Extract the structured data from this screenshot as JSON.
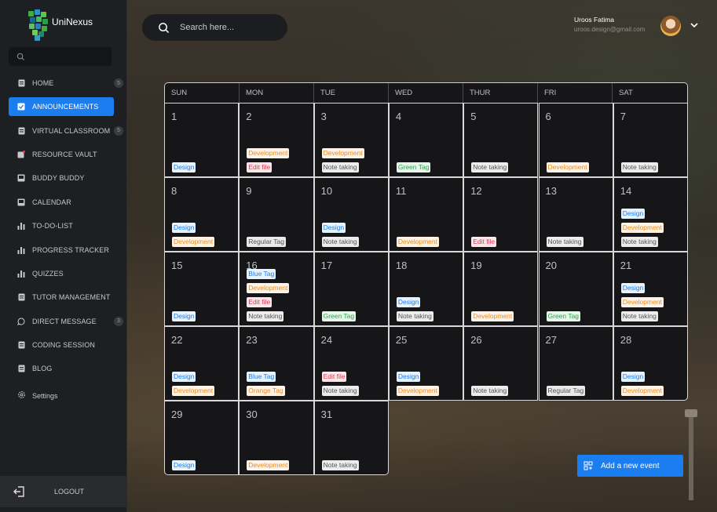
{
  "app": {
    "name": "UniNexus"
  },
  "sidebar": {
    "search_placeholder": "",
    "items": [
      {
        "label": "HOME",
        "icon": "clipboard-icon",
        "badge": "5"
      },
      {
        "label": "ANNOUNCEMENTS",
        "icon": "checkbox-icon",
        "active": true
      },
      {
        "label": "VIRTUAL CLASSROOM",
        "icon": "clipboard-icon",
        "badge": "5"
      },
      {
        "label": "RESOURCE VAULT",
        "icon": "vault-icon"
      },
      {
        "label": "BUDDY BUDDY",
        "icon": "inbox-icon"
      },
      {
        "label": "CALENDAR",
        "icon": "inbox-icon"
      },
      {
        "label": "TO-DO-LIST",
        "icon": "bar-chart-icon"
      },
      {
        "label": "PROGRESS TRACKER",
        "icon": "bar-chart-icon"
      },
      {
        "label": "QUIZZES",
        "icon": "bar-chart-icon"
      },
      {
        "label": "TUTOR MANAGEMENT",
        "icon": "clipboard-icon"
      },
      {
        "label": "DIRECT MESSAGE",
        "icon": "chat-icon",
        "badge": "3"
      },
      {
        "label": "CODING SESSION",
        "icon": "clipboard-icon"
      },
      {
        "label": "BLOG",
        "icon": "clipboard-icon"
      }
    ],
    "settings_label": "Settings",
    "logout_label": "LOGOUT"
  },
  "header": {
    "search_placeholder": "Search here...",
    "user": {
      "name": "Uroos Fatima",
      "email": "uroos.design@gmail.com"
    }
  },
  "calendar": {
    "weekdays": [
      "SUN",
      "MON",
      "TUE",
      "WED",
      "THUR",
      "FRI",
      "SAT"
    ],
    "weeks": [
      [
        {
          "day": "1",
          "tags": [
            {
              "t": "Design",
              "k": "design"
            }
          ]
        },
        {
          "day": "2",
          "tags": [
            {
              "t": "Development",
              "k": "dev"
            },
            {
              "t": "Edit file",
              "k": "edit"
            }
          ]
        },
        {
          "day": "3",
          "tags": [
            {
              "t": "Development",
              "k": "dev"
            },
            {
              "t": "Note taking",
              "k": "note"
            }
          ]
        },
        {
          "day": "4",
          "tags": [
            {
              "t": "Green Tag",
              "k": "green"
            }
          ]
        },
        {
          "day": "5",
          "tags": [
            {
              "t": "Note taking",
              "k": "note"
            }
          ]
        },
        {
          "day": "6",
          "tags": [
            {
              "t": "Development",
              "k": "dev"
            }
          ]
        },
        {
          "day": "7",
          "tags": [
            {
              "t": "Note taking",
              "k": "note"
            }
          ]
        }
      ],
      [
        {
          "day": "8",
          "tags": [
            {
              "t": "Design",
              "k": "design"
            },
            {
              "t": "Development",
              "k": "dev"
            }
          ]
        },
        {
          "day": "9",
          "tags": [
            {
              "t": "Regular Tag",
              "k": "regular"
            }
          ]
        },
        {
          "day": "10",
          "tags": [
            {
              "t": "Design",
              "k": "design"
            },
            {
              "t": "Note taking",
              "k": "note"
            }
          ]
        },
        {
          "day": "11",
          "tags": [
            {
              "t": "Development",
              "k": "dev"
            }
          ]
        },
        {
          "day": "12",
          "tags": [
            {
              "t": "Edit file",
              "k": "edit"
            }
          ]
        },
        {
          "day": "13",
          "tags": [
            {
              "t": "Note taking",
              "k": "note"
            }
          ]
        },
        {
          "day": "14",
          "tags": [
            {
              "t": "Design",
              "k": "design"
            },
            {
              "t": "Development",
              "k": "dev"
            },
            {
              "t": "Note taking",
              "k": "note"
            }
          ]
        }
      ],
      [
        {
          "day": "15",
          "tags": [
            {
              "t": "Design",
              "k": "design"
            }
          ]
        },
        {
          "day": "16",
          "tags": [
            {
              "t": "Blue Tag",
              "k": "blue"
            },
            {
              "t": "Development",
              "k": "dev"
            },
            {
              "t": "Edit file",
              "k": "edit"
            },
            {
              "t": "Note taking",
              "k": "note"
            }
          ]
        },
        {
          "day": "17",
          "tags": [
            {
              "t": "Green Tag",
              "k": "green"
            }
          ]
        },
        {
          "day": "18",
          "tags": [
            {
              "t": "Design",
              "k": "design"
            },
            {
              "t": "Note taking",
              "k": "note"
            }
          ]
        },
        {
          "day": "19",
          "tags": [
            {
              "t": "Development",
              "k": "dev"
            }
          ]
        },
        {
          "day": "20",
          "tags": [
            {
              "t": "Green Tag",
              "k": "green"
            }
          ]
        },
        {
          "day": "21",
          "tags": [
            {
              "t": "Design",
              "k": "design"
            },
            {
              "t": "Development",
              "k": "dev"
            },
            {
              "t": "Note taking",
              "k": "note"
            }
          ]
        }
      ],
      [
        {
          "day": "22",
          "tags": [
            {
              "t": "Design",
              "k": "design"
            },
            {
              "t": "Development",
              "k": "dev"
            }
          ]
        },
        {
          "day": "23",
          "tags": [
            {
              "t": "Blue Tag",
              "k": "blue"
            },
            {
              "t": "Orange Tag",
              "k": "orange"
            }
          ]
        },
        {
          "day": "24",
          "tags": [
            {
              "t": "Edit file",
              "k": "edit"
            },
            {
              "t": "Note taking",
              "k": "note"
            }
          ]
        },
        {
          "day": "25",
          "tags": [
            {
              "t": "Design",
              "k": "design"
            },
            {
              "t": "Development",
              "k": "dev"
            }
          ]
        },
        {
          "day": "26",
          "tags": [
            {
              "t": "Note taking",
              "k": "note"
            }
          ]
        },
        {
          "day": "27",
          "tags": [
            {
              "t": "Regular Tag",
              "k": "regular"
            }
          ]
        },
        {
          "day": "28",
          "tags": [
            {
              "t": "Design",
              "k": "design"
            },
            {
              "t": "Development",
              "k": "dev"
            }
          ]
        }
      ],
      [
        {
          "day": "29",
          "tags": [
            {
              "t": "Design",
              "k": "design"
            }
          ]
        },
        {
          "day": "30",
          "tags": [
            {
              "t": "Development",
              "k": "dev"
            }
          ]
        },
        {
          "day": "31",
          "tags": [
            {
              "t": "Note taking",
              "k": "note"
            }
          ]
        }
      ]
    ]
  },
  "add_event_label": "Add a new event",
  "colors": {
    "accent": "#1a7ef0",
    "sidebar_bg": "#1e1f22"
  }
}
